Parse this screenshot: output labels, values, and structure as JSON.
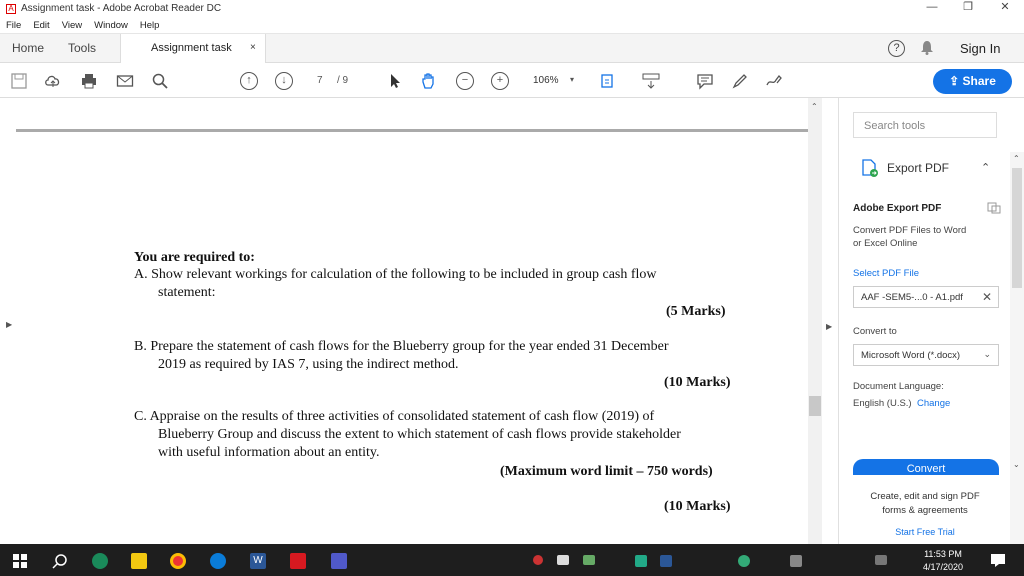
{
  "window": {
    "title": "Assignment task - Adobe Acrobat Reader DC",
    "minimize": "—",
    "maximize": "❐",
    "close": "✕"
  },
  "menu": [
    "File",
    "Edit",
    "View",
    "Window",
    "Help"
  ],
  "tabs": {
    "home": "Home",
    "tools": "Tools",
    "document": "Assignment task",
    "doc_close": "×"
  },
  "header": {
    "help": "?",
    "signin": "Sign In"
  },
  "toolbar": {
    "page_current": "7",
    "page_total": "/ 9",
    "zoom": "106%",
    "share": "Share"
  },
  "document": {
    "heading": "You are required to:",
    "a_line1": "A.  Show relevant workings for calculation of the following to be included in group cash flow",
    "a_line2": "statement:",
    "a_marks": "(5 Marks)",
    "b_line1": "B.  Prepare the statement of cash flows for the Blueberry group for the year ended 31 December",
    "b_line2": "2019 as required by IAS 7, using the indirect method.",
    "b_marks": "(10 Marks)",
    "c_line1": "C.  Appraise on the results of three activities of consolidated statement of cash flow (2019) of",
    "c_line2": "Blueberry Group and discuss the extent to which statement of cash flows provide stakeholder",
    "c_line3": "with useful information about an entity.",
    "c_limit": "(Maximum word limit – 750 words)",
    "c_marks": "(10 Marks)"
  },
  "panel": {
    "search_placeholder": "Search tools",
    "export_title": "Export PDF",
    "adobe_export": "Adobe Export PDF",
    "desc1": "Convert PDF Files to Word",
    "desc2": "or Excel Online",
    "select_file": "Select PDF File",
    "file_name": "AAF -SEM5-...0 - A1.pdf",
    "convert_to": "Convert to",
    "format": "Microsoft Word (*.docx)",
    "doc_language": "Document Language:",
    "language": "English (U.S.)",
    "change": "Change",
    "convert_btn": "Convert",
    "promo1": "Create, edit and sign PDF",
    "promo2": "forms & agreements",
    "trial": "Start Free Trial"
  },
  "taskbar": {
    "time": "11:53 PM",
    "date": "4/17/2020"
  },
  "colors": {
    "accent": "#1473e6",
    "acrobat_red": "#d71920"
  }
}
